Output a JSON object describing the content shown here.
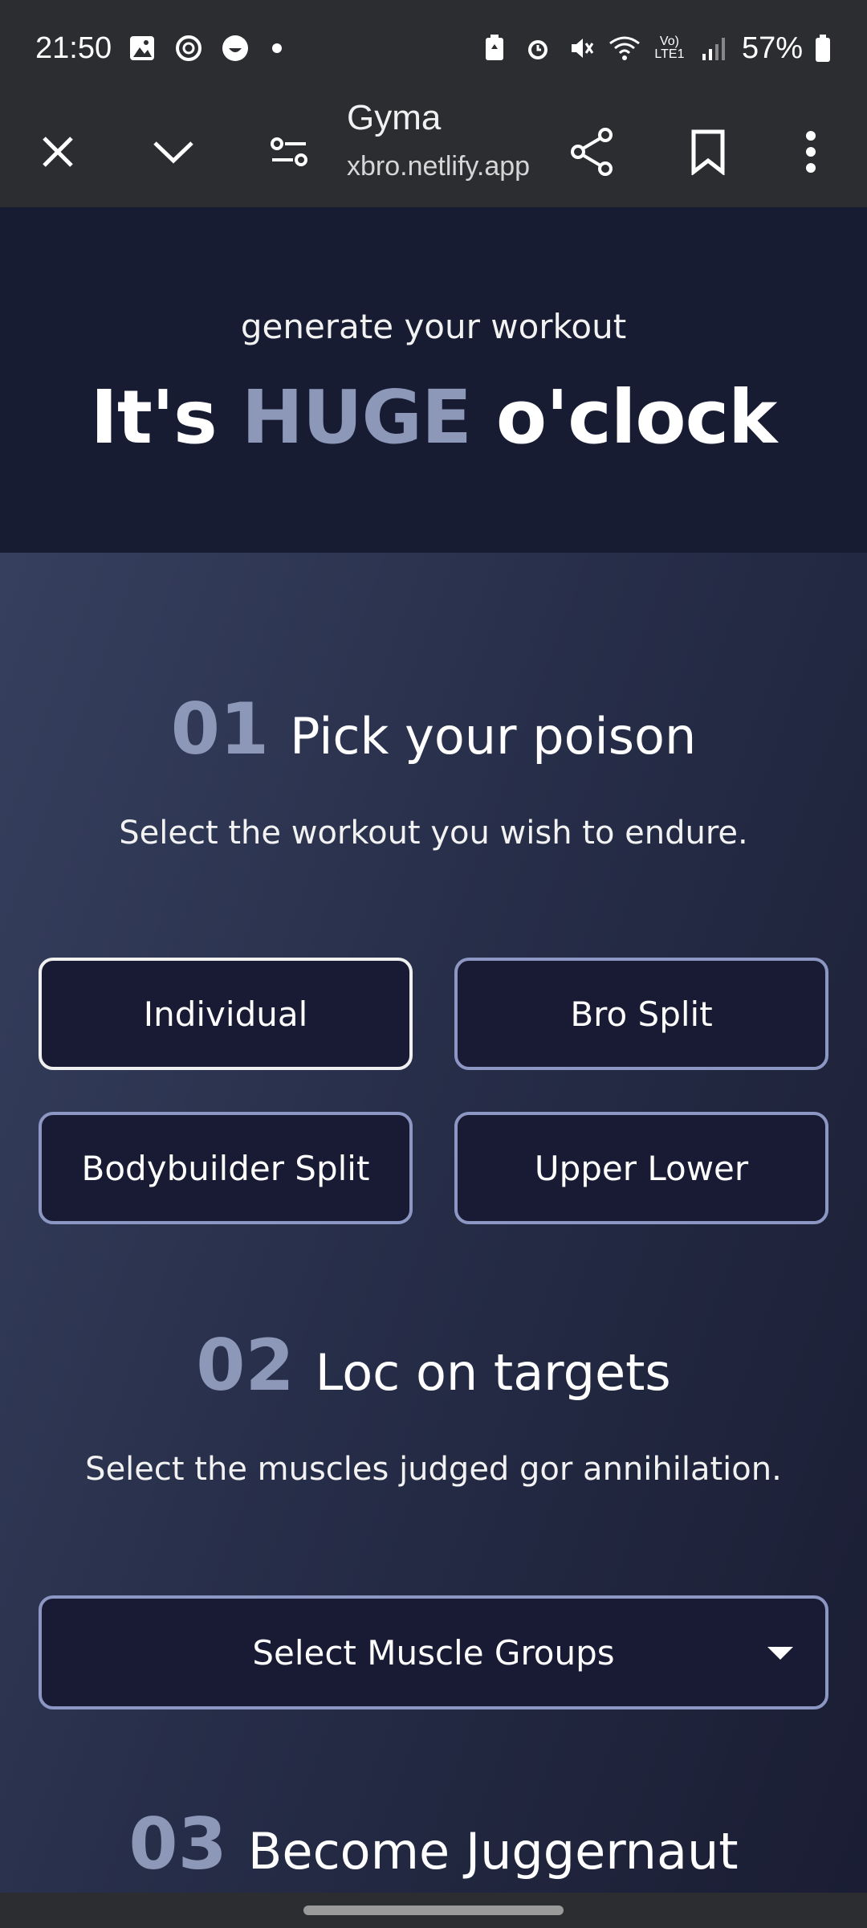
{
  "status_bar": {
    "time": "21:50",
    "left_icons": [
      "image-icon",
      "sync-icon",
      "face-icon"
    ],
    "right_icons": [
      "battery-saver-icon",
      "alarm-icon",
      "mute-icon",
      "wifi-icon",
      "volte-icon",
      "signal-icon"
    ],
    "volte_text": "Vo) LTE1",
    "battery": "57%"
  },
  "browser": {
    "title": "Gyma",
    "url": "xbro.netlify.app",
    "buttons": [
      "close-icon",
      "chevron-down-icon",
      "tune-icon",
      "share-icon",
      "bookmark-icon",
      "more-vert-icon"
    ]
  },
  "hero": {
    "subtitle": "generate your workout",
    "title_pre": "It's ",
    "title_highlight": "HUGE",
    "title_post": " o'clock"
  },
  "steps": [
    {
      "num": "01",
      "title": "Pick your poison",
      "desc": "Select the workout you wish to endure.",
      "options": [
        "Individual",
        "Bro Split",
        "Bodybuilder Split",
        "Upper Lower"
      ],
      "selected": "Individual"
    },
    {
      "num": "02",
      "title": "Loc on targets",
      "desc": "Select the muscles judged gor annihilation.",
      "select_label": "Select Muscle Groups"
    },
    {
      "num": "03",
      "title": "Become Juggernaut"
    }
  ],
  "colors": {
    "accent": "#8d97b8",
    "border": "#8d97c4",
    "button_bg": "#181b33",
    "hero_bg": "#171c33"
  }
}
